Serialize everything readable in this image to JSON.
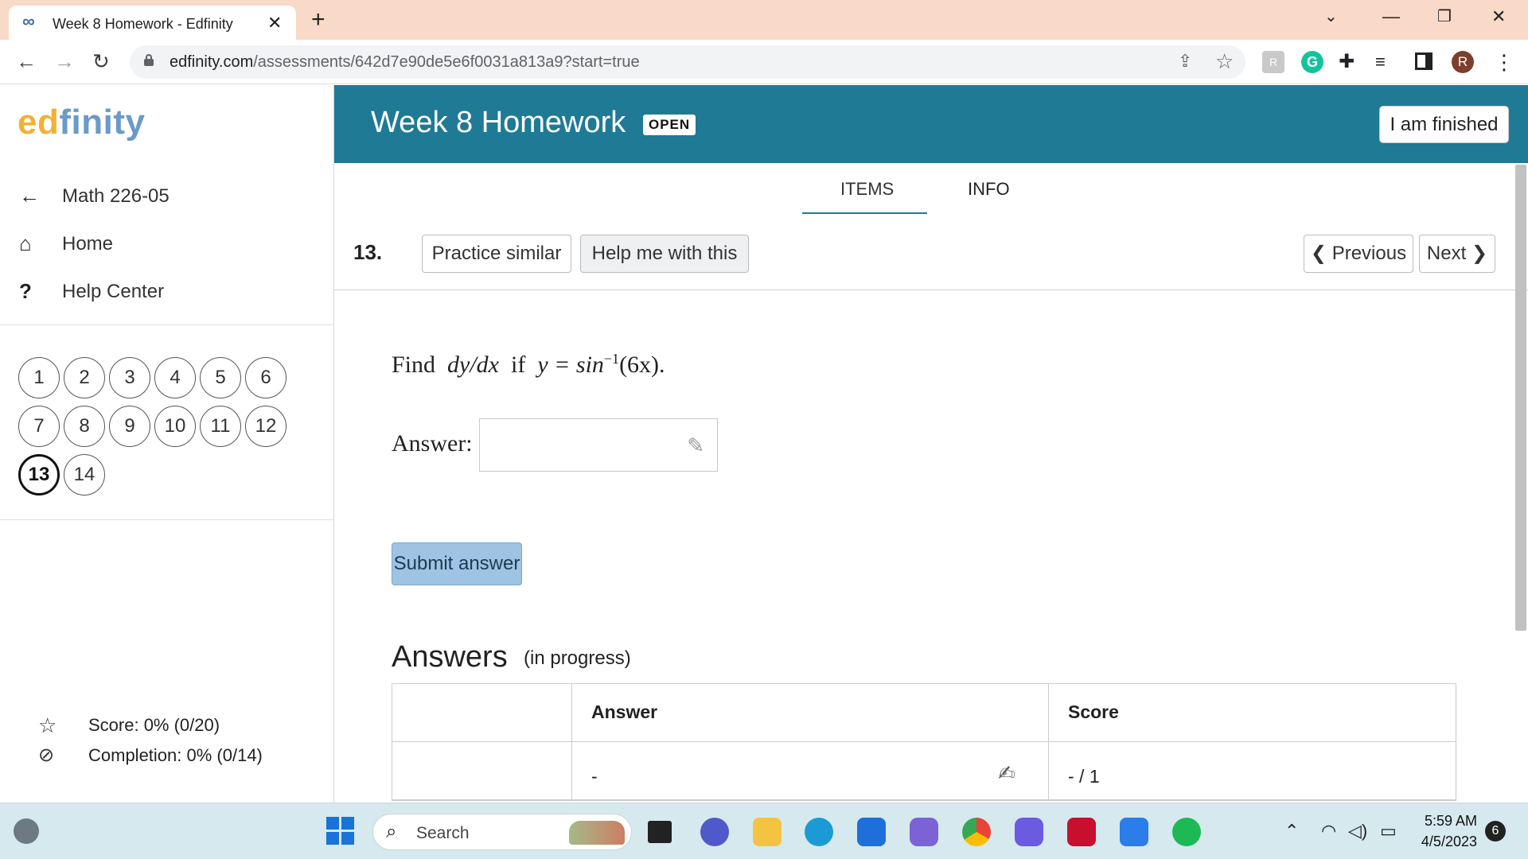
{
  "browser": {
    "tab_title": "Week 8 Homework - Edfinity",
    "url_host": "edfinity.com",
    "url_path": "/assessments/642d7e90de5e6f0031a813a9?start=true",
    "avatar_letter": "R"
  },
  "sidebar": {
    "logo_ed": "ed",
    "logo_finity": "finity",
    "nav": [
      {
        "label": "Math 226-05",
        "icon": "arrow-left-icon"
      },
      {
        "label": "Home",
        "icon": "home-icon"
      },
      {
        "label": "Help Center",
        "icon": "question-icon"
      }
    ],
    "questions": [
      "1",
      "2",
      "3",
      "4",
      "5",
      "6",
      "7",
      "8",
      "9",
      "10",
      "11",
      "12",
      "13",
      "14"
    ],
    "active_question": "13",
    "score_label": "Score: 0% (0/20)",
    "completion_label": "Completion: 0% (0/14)"
  },
  "header": {
    "title": "Week 8 Homework",
    "status_badge": "OPEN",
    "finish_button": "I am finished"
  },
  "tabs": {
    "items": "ITEMS",
    "info": "INFO"
  },
  "question": {
    "number": "13.",
    "practice_button": "Practice similar",
    "help_button": "Help me with this",
    "prev_button": "Previous",
    "next_button": "Next",
    "prompt_find": "Find",
    "prompt_dydx": "dy/dx",
    "prompt_if": "if",
    "prompt_eq": "y = sin",
    "prompt_exp": "−1",
    "prompt_arg": "(6x).",
    "answer_label": "Answer:",
    "answer_value": "",
    "submit_button": "Submit answer"
  },
  "answers": {
    "title": "Answers",
    "subtitle": "(in progress)",
    "columns": [
      "",
      "Answer",
      "Score"
    ],
    "rows": [
      {
        "label": "",
        "answer": "-",
        "score": "- / 1"
      }
    ]
  },
  "taskbar": {
    "search_placeholder": "Search",
    "time": "5:59 AM",
    "date": "4/5/2023",
    "notifications": "6"
  },
  "colors": {
    "header_bg": "#1f7a96",
    "tab_strip": "#f9d9c7",
    "submit_bg": "#9fc3e3",
    "logo_ed": "#f2b135",
    "logo_finity": "#6b9ac9"
  }
}
